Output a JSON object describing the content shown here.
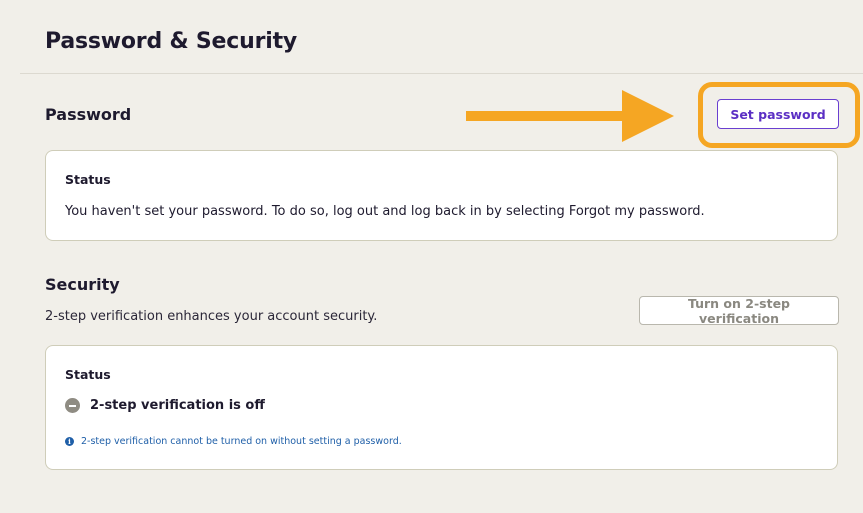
{
  "page": {
    "title": "Password & Security"
  },
  "password_section": {
    "heading": "Password",
    "set_button_label": "Set password",
    "status_label": "Status",
    "status_text": "You haven't set your password. To do so, log out and log back in by selecting Forgot my password."
  },
  "security_section": {
    "heading": "Security",
    "description": "2-step verification enhances your account security.",
    "enable_button_label": "Turn on 2-step verification",
    "status_label": "Status",
    "status_icon": "minus-circle-icon",
    "status_value": "2-step verification is off",
    "info_icon": "info-icon",
    "info_text": "2-step verification cannot be turned on without setting a password."
  },
  "colors": {
    "background": "#f1efe9",
    "accent": "#5b2fc4",
    "highlight": "#f5a623",
    "info": "#1f5fa8"
  }
}
